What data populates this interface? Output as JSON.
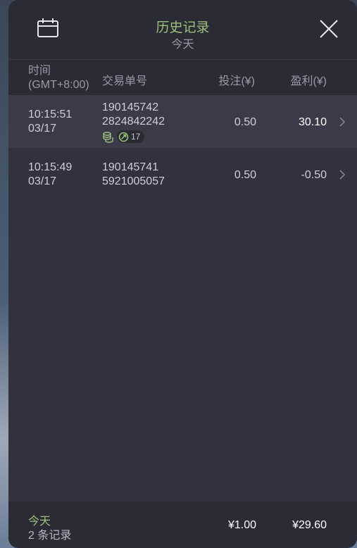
{
  "header": {
    "title": "历史记录",
    "subtitle": "今天",
    "left_icon": "calendar-icon",
    "right_icon": "close-icon"
  },
  "columns": {
    "time_line1": "时间",
    "time_line2": "(GMT+8:00)",
    "order": "交易单号",
    "bet": "投注(¥)",
    "profit": "盈利(¥)"
  },
  "rows": [
    {
      "time": "10:15:51",
      "date": "03/17",
      "order_line1": "190145742",
      "order_line2": "2824842242",
      "bet": "0.50",
      "profit": "30.10",
      "badge_count": "17"
    },
    {
      "time": "10:15:49",
      "date": "03/17",
      "order_line1": "190145741",
      "order_line2": "5921005057",
      "bet": "0.50",
      "profit": "-0.50"
    }
  ],
  "footer": {
    "label": "今天",
    "count": "2 条记录",
    "total_bet": "¥1.00",
    "total_profit": "¥29.60"
  },
  "colors": {
    "accent": "#9bc27a",
    "panel": "#32323f",
    "header": "#2b2b36",
    "highlight_row": "#3a3a48"
  }
}
